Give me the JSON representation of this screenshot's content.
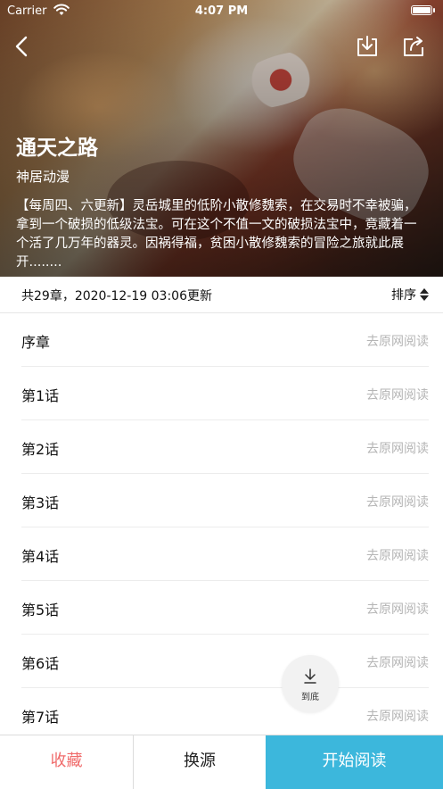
{
  "status_bar": {
    "carrier": "Carrier",
    "time": "4:07 PM",
    "icons": [
      "wifi-icon",
      "battery-icon"
    ]
  },
  "nav": {
    "icons": [
      "back-chevron-icon",
      "download-icon",
      "share-icon"
    ]
  },
  "comic": {
    "title": "通天之路",
    "author": "神居动漫",
    "description": "【每周四、六更新】灵岳城里的低阶小散修魏索，在交易时不幸被骗，拿到一个破损的低级法宝。可在这个不值一文的破损法宝中，竟藏着一个活了几万年的器灵。因祸得福，贫困小散修魏索的冒险之旅就此展开........"
  },
  "info": {
    "chapter_count": "共29章，2020-12-19 03:06更新",
    "sort_label": "排序"
  },
  "chapters": [
    {
      "name": "序章",
      "link": "去原网阅读"
    },
    {
      "name": "第1话",
      "link": "去原网阅读"
    },
    {
      "name": "第2话",
      "link": "去原网阅读"
    },
    {
      "name": "第3话",
      "link": "去原网阅读"
    },
    {
      "name": "第4话",
      "link": "去原网阅读"
    },
    {
      "name": "第5话",
      "link": "去原网阅读"
    },
    {
      "name": "第6话",
      "link": "去原网阅读"
    },
    {
      "name": "第7话",
      "link": "去原网阅读"
    }
  ],
  "scroll_to_bottom": {
    "label": "到底"
  },
  "bottom_bar": {
    "favorite": "收藏",
    "change_source": "换源",
    "start_reading": "开始阅读"
  },
  "colors": {
    "accent": "#3cb7dc",
    "favorite": "#f06b6b",
    "link_gray": "#b5b5b5"
  }
}
